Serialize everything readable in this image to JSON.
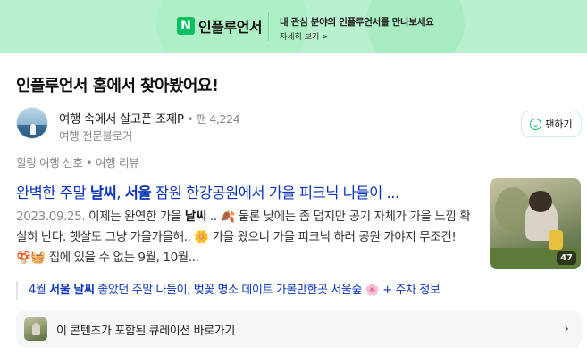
{
  "banner": {
    "logo_letter": "N",
    "brand": "인플루언서",
    "message": "내 관심 분야의 인플루언서를 만나보세요",
    "more": "자세히 보기 >"
  },
  "section_title": "인플루언서 홈에서 찾아봤어요!",
  "author": {
    "name": "여행 속에서 살고픈 조제P",
    "fans": " • 팬 4,224",
    "description": "여행 전문블로거",
    "fan_button_label": "팬하기"
  },
  "category": "힐링 여행 선호 • 여행 리뷰",
  "article": {
    "title_parts": [
      "완벽한 주말 ",
      "날씨",
      ", ",
      "서울",
      " 잠원 한강공원에서 가을 피크닉 나들이 ..."
    ],
    "date": "2023.09.25.",
    "body_parts": [
      " 이제는 완연한 가을 ",
      "날씨",
      " .. 🍂 물론 낮에는 좀 덥지만 공기 자체가 가을 느낌 확실히 난다. 햇살도 그냥 가을가을해.. 🌼 가을 왔으니 가을 피크닉 하러 공원 가야지 무조건! 🍄🧺 집에 있을 수 없는 9월, 10월..."
    ],
    "image_count": "47"
  },
  "related": {
    "parts": [
      "4월 ",
      "서울 날씨",
      " 좋았던 주말 나들이, 벚꽃 명소 데이트 가볼만한곳 서울숲 🌸 + 주차 정보"
    ]
  },
  "curation": {
    "label": "이 콘텐츠가 포함된 큐레이션 바로가기",
    "chevron": "›"
  },
  "colors": {
    "banner_bg": "#b9f0cf",
    "brand_green": "#0bbf62",
    "link_blue": "#0a35b8"
  }
}
